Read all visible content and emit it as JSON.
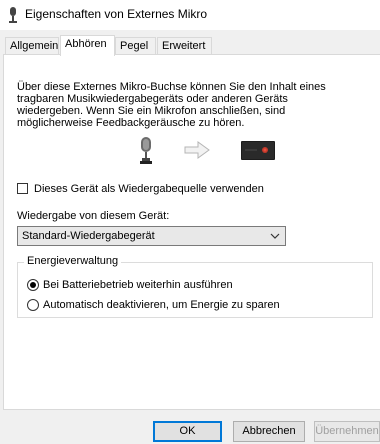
{
  "window": {
    "title": "Eigenschaften von Externes Mikro"
  },
  "tabs": [
    {
      "label": "Allgemein",
      "active": false
    },
    {
      "label": "Abhören",
      "active": true
    },
    {
      "label": "Pegel",
      "active": false
    },
    {
      "label": "Erweitert",
      "active": false
    }
  ],
  "description": {
    "line1": "Über diese Externes Mikro-Buchse können Sie den Inhalt eines",
    "line2": "tragbaren Musikwiedergabegeräts oder anderen Geräts",
    "line3": "wiedergeben. Wenn Sie ein Mikrofon anschließen, sind",
    "line4": "möglicherweise Feedbackgeräusche zu hören."
  },
  "icons": {
    "mic": "microphone-icon",
    "arrow": "arrow-right-icon",
    "device": "playback-device-icon"
  },
  "listen_checkbox": {
    "label": "Dieses Gerät als Wiedergabequelle verwenden",
    "checked": false
  },
  "playback": {
    "label": "Wiedergabe von diesem Gerät:",
    "selected": "Standard-Wiedergabegerät"
  },
  "power": {
    "title": "Energieverwaltung",
    "options": [
      {
        "label": "Bei Batteriebetrieb weiterhin ausführen",
        "checked": true
      },
      {
        "label": "Automatisch deaktivieren, um Energie zu sparen",
        "checked": false
      }
    ]
  },
  "buttons": {
    "ok": "OK",
    "cancel": "Abbrechen",
    "apply": "Übernehmen"
  },
  "colors": {
    "accent": "#0078d7",
    "device_led": "#c0392b"
  }
}
